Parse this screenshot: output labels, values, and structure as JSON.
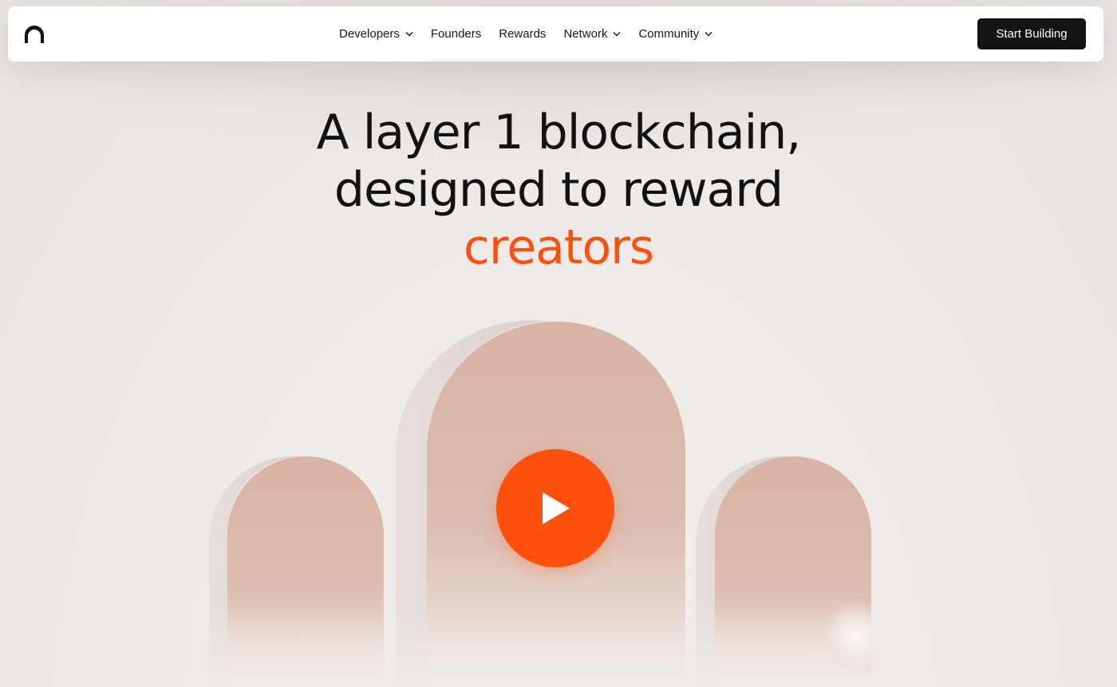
{
  "nav": {
    "logo_icon": "arch-logo-icon",
    "items": [
      {
        "label": "Developers",
        "dropdown": true
      },
      {
        "label": "Founders",
        "dropdown": false
      },
      {
        "label": "Rewards",
        "dropdown": false
      },
      {
        "label": "Network",
        "dropdown": true
      },
      {
        "label": "Community",
        "dropdown": true
      }
    ],
    "cta_label": "Start Building"
  },
  "hero": {
    "line1": "A layer 1 blockchain,",
    "line2": "designed to reward",
    "line3": "creators"
  },
  "media": {
    "play_icon": "play-icon"
  },
  "colors": {
    "accent": "#ff4f0d",
    "cta_bg": "#141212",
    "background": "#efebe8",
    "arch": "#dcb8a8"
  }
}
